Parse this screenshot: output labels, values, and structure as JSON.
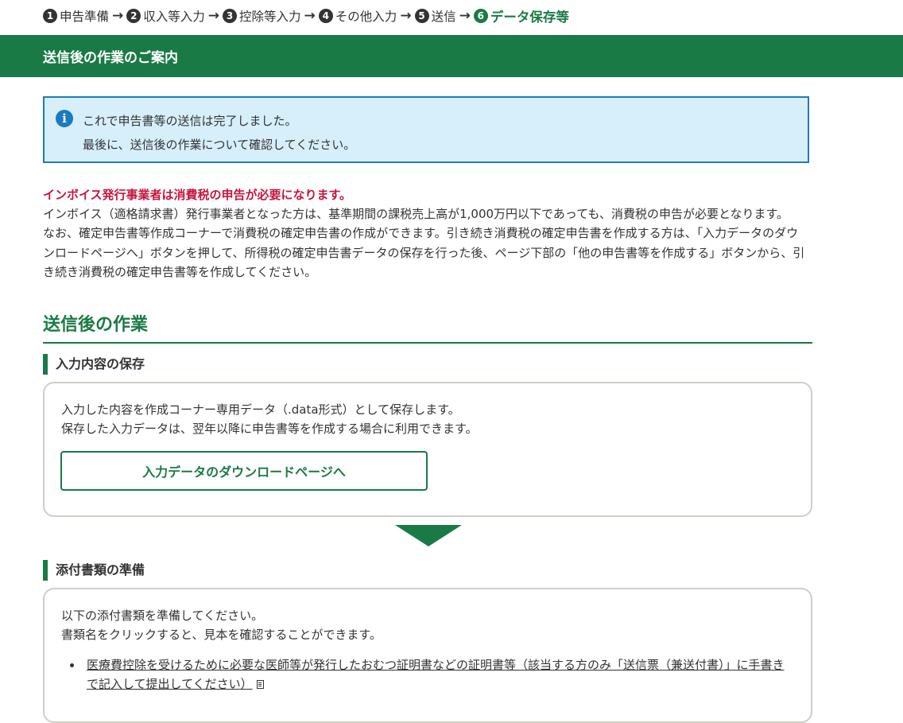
{
  "stepper": {
    "steps": [
      {
        "num": "1",
        "label": "申告準備"
      },
      {
        "num": "2",
        "label": "収入等入力"
      },
      {
        "num": "3",
        "label": "控除等入力"
      },
      {
        "num": "4",
        "label": "その他入力"
      },
      {
        "num": "5",
        "label": "送信"
      },
      {
        "num": "6",
        "label": "データ保存等"
      }
    ],
    "arrow": "→",
    "active_color": "#1a7a45"
  },
  "header": {
    "title": "送信後の作業のご案内",
    "bg_color": "#1a7a45"
  },
  "info": {
    "icon": "info-icon",
    "line1": "これで申告書等の送信は完了しました。",
    "line2": "最後に、送信後の作業について確認してください。"
  },
  "notice": {
    "title": "インボイス発行事業者は消費税の申告が必要になります。",
    "p1": "インボイス（適格請求書）発行事業者となった方は、基準期間の課税売上高が1,000万円以下であっても、消費税の申告が必要となります。",
    "p2": "なお、確定申告書等作成コーナーで消費税の確定申告書の作成ができます。引き続き消費税の確定申告書を作成する方は、「入力データのダウンロードページへ」ボタンを押して、所得税の確定申告書データの保存を行った後、ページ下部の「他の申告書等を作成する」ボタンから、引き続き消費税の確定申告書等を作成してください。",
    "title_color": "#c8143c"
  },
  "section": {
    "title": "送信後の作業"
  },
  "save": {
    "heading": "入力内容の保存",
    "line1": "入力した内容を作成コーナー専用データ（.data形式）として保存します。",
    "line2": "保存した入力データは、翌年以降に申告書等を作成する場合に利用できます。",
    "button_label": "入力データのダウンロードページへ"
  },
  "attachments": {
    "heading": "添付書類の準備",
    "line1": "以下の添付書類を準備してください。",
    "line2": "書類名をクリックすると、見本を確認することができます。",
    "items": [
      {
        "label": "医療費控除を受けるために必要な医師等が発行したおむつ証明書などの証明書等（該当する方のみ「送信票（兼送付書）」に手書きで記入して提出してください）",
        "icon": "document-icon"
      }
    ]
  }
}
